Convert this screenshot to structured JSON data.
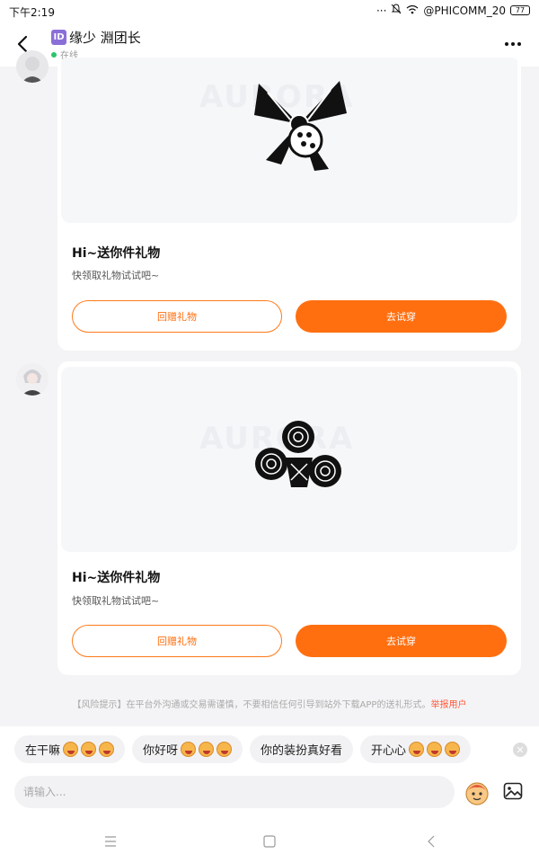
{
  "status_bar": {
    "time": "下午2:19",
    "network": "@PHICOMM_20",
    "battery": "77"
  },
  "header": {
    "id_badge": "ID",
    "title": "缘少 淵团长",
    "status": "在线"
  },
  "messages": [
    {
      "watermark": "AURORA",
      "title": "Hi~送你件礼物",
      "subtitle": "快领取礼物试试吧~",
      "return_gift_label": "回赠礼物",
      "try_on_label": "去试穿"
    },
    {
      "watermark": "AURORA",
      "title": "Hi~送你件礼物",
      "subtitle": "快领取礼物试试吧~",
      "return_gift_label": "回赠礼物",
      "try_on_label": "去试穿"
    }
  ],
  "risk_notice": {
    "text": "【风险提示】在平台外沟通或交易需谨慎，不要相信任何引导到站外下载APP的送礼形式。",
    "report_label": "举报用户"
  },
  "quick_replies": [
    {
      "text": "在干嘛",
      "emoji_count": 3
    },
    {
      "text": "你好呀",
      "emoji_count": 3
    },
    {
      "text": "你的装扮真好看",
      "emoji_count": 0
    },
    {
      "text": "开心心",
      "emoji_count": 3
    }
  ],
  "composer": {
    "placeholder": "请输入..."
  },
  "colors": {
    "accent": "#ff6f10",
    "online": "#2bc36b",
    "id_badge": "#8b6fd8"
  },
  "icons": {
    "back": "chevron-left",
    "more": "ellipsis",
    "emoji": "emoji-sticker",
    "image": "image-picker",
    "nav_menu": "hamburger",
    "nav_home": "square",
    "nav_back": "chevron-left"
  }
}
